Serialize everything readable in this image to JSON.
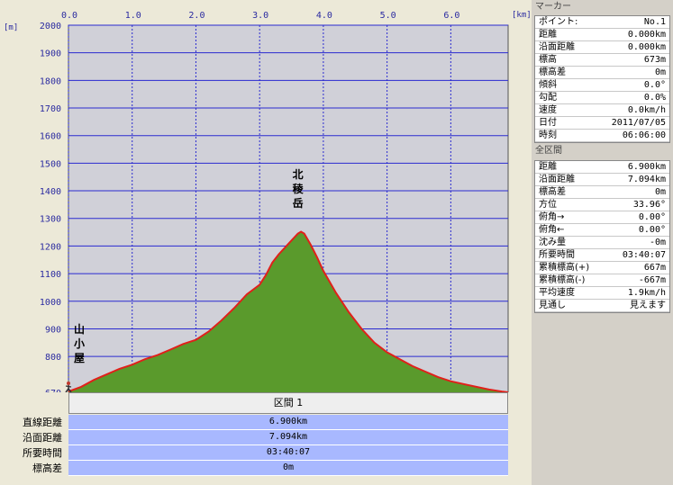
{
  "chart_data": {
    "type": "area",
    "title": "",
    "xlabel": "[km]",
    "ylabel": "[m]",
    "xlim": [
      0,
      6.9
    ],
    "ylim": [
      670,
      2000
    ],
    "x_ticks": [
      "0.0",
      "1.0",
      "2.0",
      "3.0",
      "4.0",
      "5.0",
      "6.0"
    ],
    "y_ticks": [
      "2000",
      "1900",
      "1800",
      "1700",
      "1600",
      "1500",
      "1400",
      "1300",
      "1200",
      "1100",
      "1000",
      "900",
      "800",
      "670"
    ],
    "grid": true,
    "fill_color": "#5a9a2c",
    "line_color": "#e0201a",
    "series": [
      {
        "x": [
          0.0,
          0.2,
          0.4,
          0.6,
          0.8,
          1.0,
          1.2,
          1.4,
          1.6,
          1.8,
          2.0,
          2.2,
          2.4,
          2.6,
          2.8,
          3.0,
          3.1,
          3.2,
          3.3,
          3.4,
          3.5,
          3.6,
          3.65,
          3.7,
          3.8,
          3.9,
          4.0,
          4.2,
          4.4,
          4.6,
          4.8,
          5.0,
          5.2,
          5.4,
          5.6,
          5.8,
          6.0,
          6.2,
          6.4,
          6.6,
          6.8,
          6.9
        ],
        "y": [
          673,
          690,
          715,
          735,
          755,
          770,
          790,
          805,
          825,
          845,
          860,
          890,
          930,
          975,
          1025,
          1060,
          1095,
          1140,
          1170,
          1195,
          1220,
          1245,
          1252,
          1245,
          1205,
          1160,
          1110,
          1030,
          960,
          900,
          850,
          815,
          790,
          765,
          745,
          725,
          710,
          700,
          690,
          680,
          673,
          670
        ]
      }
    ],
    "annotations": [
      {
        "text": "北稜岳",
        "x": 3.6,
        "y": 1385
      },
      {
        "text": "山小屋",
        "x": 0.0,
        "y": 840
      }
    ]
  },
  "summary": {
    "header": "区間 1",
    "rows": [
      {
        "key": "直線距離",
        "value": "6.900km"
      },
      {
        "key": "沿面距離",
        "value": "7.094km"
      },
      {
        "key": "所要時間",
        "value": "03:40:07"
      },
      {
        "key": "標高差",
        "value": "0m"
      }
    ]
  },
  "marker_panel": {
    "title": "マーカー",
    "rows": [
      {
        "key": "ポイント:",
        "value": "No.1"
      },
      {
        "key": "距離",
        "value": "0.000km"
      },
      {
        "key": "沿面距離",
        "value": "0.000km"
      },
      {
        "key": "標高",
        "value": "673m"
      },
      {
        "key": "標高差",
        "value": "0m"
      },
      {
        "key": "傾斜",
        "value": "0.0°"
      },
      {
        "key": "勾配",
        "value": "0.0%"
      },
      {
        "key": "速度",
        "value": "0.0km/h"
      },
      {
        "key": "日付",
        "value": "2011/07/05"
      },
      {
        "key": "時刻",
        "value": "06:06:00"
      }
    ]
  },
  "section_panel": {
    "title": "全区間",
    "rows": [
      {
        "key": "距離",
        "value": "6.900km"
      },
      {
        "key": "沿面距離",
        "value": "7.094km"
      },
      {
        "key": "標高差",
        "value": "0m"
      },
      {
        "key": "方位",
        "value": "33.96°"
      },
      {
        "key": "俯角→",
        "value": "0.00°"
      },
      {
        "key": "俯角←",
        "value": "0.00°"
      },
      {
        "key": "沈み量",
        "value": "-0m"
      },
      {
        "key": "所要時間",
        "value": "03:40:07"
      },
      {
        "key": "累積標高(+)",
        "value": "667m"
      },
      {
        "key": "累積標高(-)",
        "value": "-667m"
      },
      {
        "key": "平均速度",
        "value": "1.9km/h"
      },
      {
        "key": "見通し",
        "value": "見えます"
      }
    ]
  }
}
